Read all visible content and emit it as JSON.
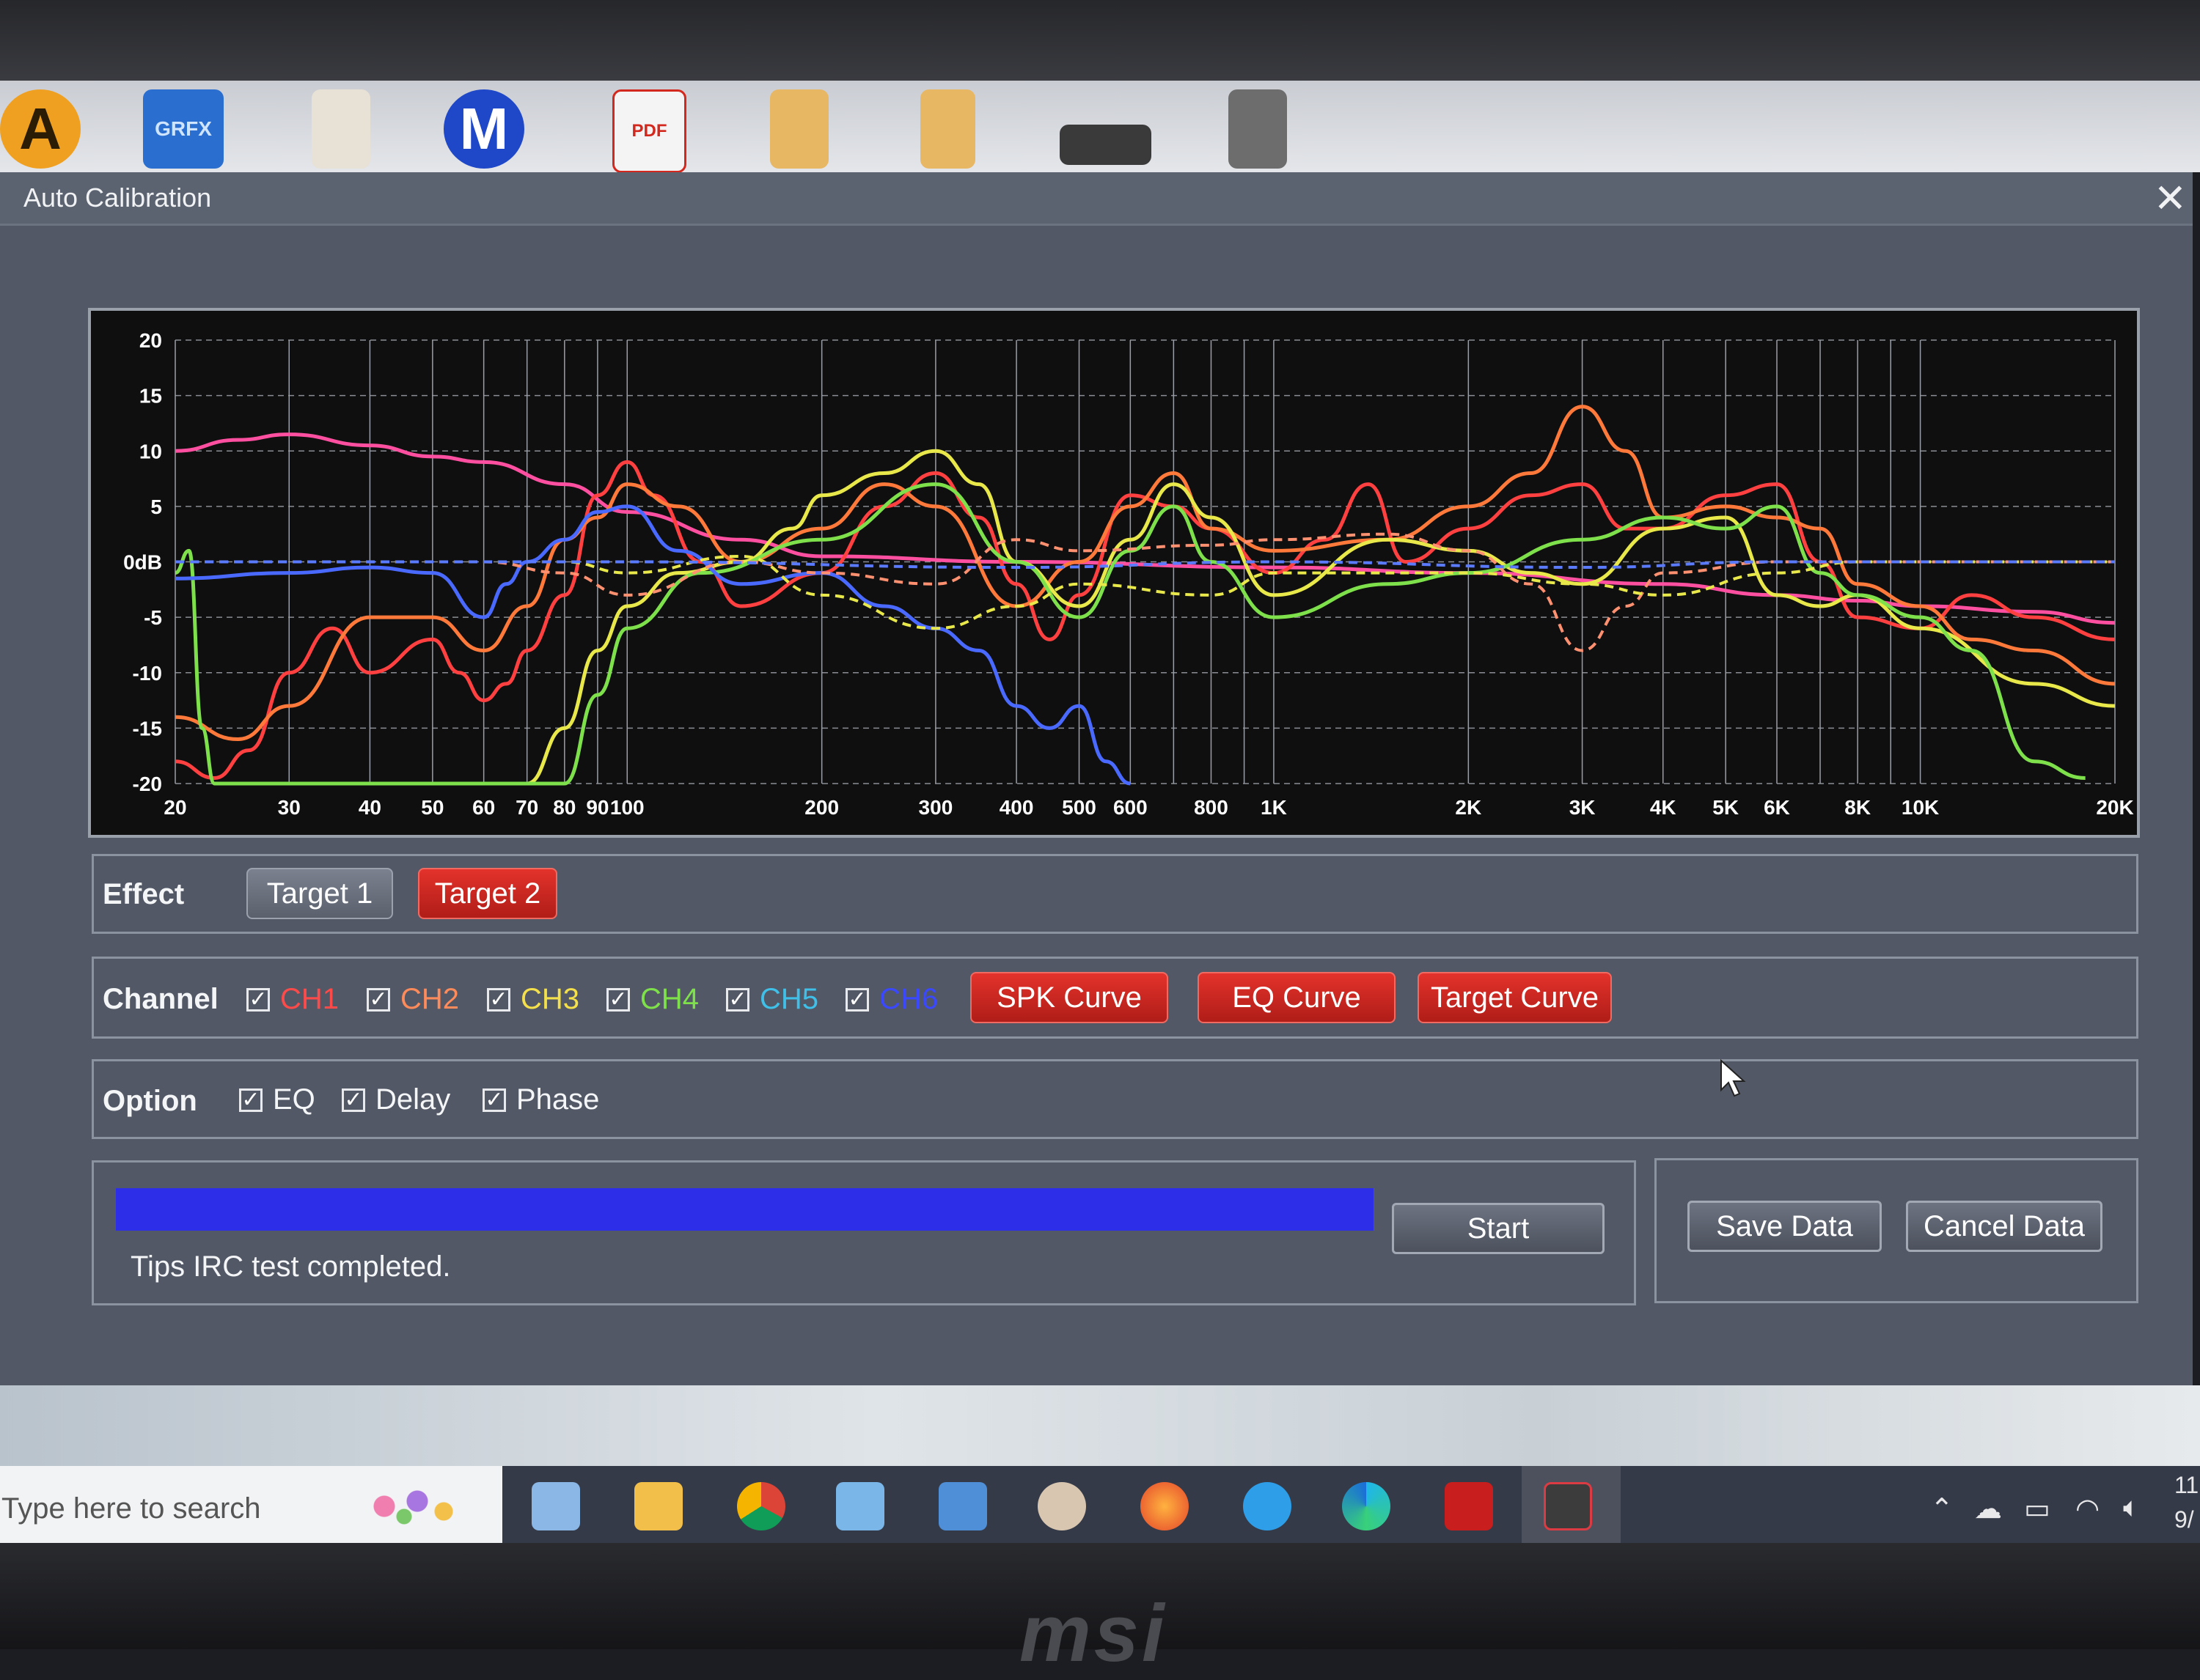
{
  "desktop": {
    "icons": [
      {
        "name": "avast-icon",
        "label": "A",
        "color": "#f0a020"
      },
      {
        "name": "grfx-icon",
        "label": "GRFX",
        "color": "#2a6fd0"
      },
      {
        "name": "pdf-file-icon",
        "label": "",
        "color": "#e8e1d6"
      },
      {
        "name": "malwarebytes-icon",
        "label": "M",
        "color": "#1f48c8"
      },
      {
        "name": "acrobat-pdf-icon",
        "label": "PDF",
        "color": "#f4f4f4"
      },
      {
        "name": "folder-icon",
        "label": "",
        "color": "#e7b764"
      },
      {
        "name": "folder-icon-2",
        "label": "",
        "color": "#e7b764"
      },
      {
        "name": "video-thumbnail-icon",
        "label": "",
        "color": "#3a3a3a"
      },
      {
        "name": "folder-image-icon",
        "label": "",
        "color": "#6d6d6d"
      }
    ]
  },
  "window": {
    "title": "Auto Calibration",
    "close_glyph": "✕"
  },
  "chart_data": {
    "type": "line",
    "x_scale": "log",
    "xlim": [
      20,
      20000
    ],
    "ylim": [
      -20,
      20
    ],
    "y_ticks": [
      "20",
      "15",
      "10",
      "5",
      "0dB",
      "-5",
      "-10",
      "-15",
      "-20"
    ],
    "x_ticks": [
      {
        "v": 20,
        "l": "20"
      },
      {
        "v": 30,
        "l": "30"
      },
      {
        "v": 40,
        "l": "40"
      },
      {
        "v": 50,
        "l": "50"
      },
      {
        "v": 60,
        "l": "60"
      },
      {
        "v": 70,
        "l": "70"
      },
      {
        "v": 80,
        "l": "80"
      },
      {
        "v": 90,
        "l": "90"
      },
      {
        "v": 100,
        "l": "100"
      },
      {
        "v": 200,
        "l": "200"
      },
      {
        "v": 300,
        "l": "300"
      },
      {
        "v": 400,
        "l": "400"
      },
      {
        "v": 500,
        "l": "500"
      },
      {
        "v": 600,
        "l": "600"
      },
      {
        "v": 800,
        "l": "800"
      },
      {
        "v": 1000,
        "l": "1K"
      },
      {
        "v": 2000,
        "l": "2K"
      },
      {
        "v": 3000,
        "l": "3K"
      },
      {
        "v": 4000,
        "l": "4K"
      },
      {
        "v": 5000,
        "l": "5K"
      },
      {
        "v": 6000,
        "l": "6K"
      },
      {
        "v": 8000,
        "l": "8K"
      },
      {
        "v": 10000,
        "l": "10K"
      },
      {
        "v": 20000,
        "l": "20K"
      }
    ],
    "grid": true,
    "series": [
      {
        "color": "#ff4fa0",
        "dashed": false,
        "points": [
          [
            20,
            10
          ],
          [
            25,
            11
          ],
          [
            30,
            11.5
          ],
          [
            40,
            10.5
          ],
          [
            50,
            9.5
          ],
          [
            60,
            9
          ],
          [
            80,
            7
          ],
          [
            100,
            4.5
          ],
          [
            150,
            2
          ],
          [
            200,
            0.5
          ],
          [
            400,
            0
          ],
          [
            1000,
            -0.5
          ],
          [
            2000,
            -1
          ],
          [
            4000,
            -2
          ],
          [
            6000,
            -3
          ],
          [
            8000,
            -3.5
          ],
          [
            10000,
            -4
          ],
          [
            15000,
            -4.5
          ],
          [
            20000,
            -5.5
          ]
        ]
      },
      {
        "color": "#ff4040",
        "dashed": false,
        "points": [
          [
            20,
            -18
          ],
          [
            23,
            -19.5
          ],
          [
            26,
            -17
          ],
          [
            30,
            -10
          ],
          [
            35,
            -6
          ],
          [
            40,
            -10
          ],
          [
            50,
            -7
          ],
          [
            55,
            -10
          ],
          [
            60,
            -12.5
          ],
          [
            65,
            -11
          ],
          [
            70,
            -8
          ],
          [
            80,
            -3
          ],
          [
            90,
            6
          ],
          [
            100,
            9
          ],
          [
            110,
            6
          ],
          [
            130,
            0
          ],
          [
            150,
            -4
          ],
          [
            200,
            -1
          ],
          [
            250,
            5
          ],
          [
            300,
            8
          ],
          [
            350,
            4
          ],
          [
            400,
            -2
          ],
          [
            450,
            -7
          ],
          [
            500,
            -3
          ],
          [
            600,
            6
          ],
          [
            700,
            5
          ],
          [
            800,
            3
          ],
          [
            1000,
            -1
          ],
          [
            1200,
            2
          ],
          [
            1400,
            7
          ],
          [
            1600,
            0
          ],
          [
            2000,
            3
          ],
          [
            2500,
            6
          ],
          [
            3000,
            7
          ],
          [
            3500,
            3
          ],
          [
            4000,
            3
          ],
          [
            5000,
            6
          ],
          [
            6000,
            7
          ],
          [
            7000,
            0
          ],
          [
            8000,
            -5
          ],
          [
            10000,
            -6
          ],
          [
            12000,
            -3
          ],
          [
            15000,
            -5
          ],
          [
            20000,
            -7
          ]
        ]
      },
      {
        "color": "#ff7a3a",
        "dashed": false,
        "points": [
          [
            20,
            -14
          ],
          [
            25,
            -16
          ],
          [
            30,
            -13
          ],
          [
            40,
            -5
          ],
          [
            50,
            -5
          ],
          [
            60,
            -8
          ],
          [
            70,
            -4
          ],
          [
            80,
            2
          ],
          [
            90,
            4
          ],
          [
            100,
            7
          ],
          [
            120,
            5
          ],
          [
            150,
            0
          ],
          [
            200,
            3
          ],
          [
            250,
            7
          ],
          [
            300,
            5
          ],
          [
            400,
            -4
          ],
          [
            500,
            0
          ],
          [
            600,
            5
          ],
          [
            700,
            8
          ],
          [
            800,
            3
          ],
          [
            1000,
            1
          ],
          [
            1500,
            2
          ],
          [
            2000,
            5
          ],
          [
            2500,
            8
          ],
          [
            3000,
            14
          ],
          [
            3500,
            10
          ],
          [
            4000,
            4
          ],
          [
            5000,
            5
          ],
          [
            6000,
            4
          ],
          [
            7000,
            3
          ],
          [
            8000,
            -2
          ],
          [
            10000,
            -4
          ],
          [
            12000,
            -7
          ],
          [
            15000,
            -8
          ],
          [
            20000,
            -11
          ]
        ]
      },
      {
        "color": "#e8e84a",
        "dashed": false,
        "points": [
          [
            70,
            -20
          ],
          [
            80,
            -15
          ],
          [
            90,
            -8
          ],
          [
            100,
            -4
          ],
          [
            120,
            -1
          ],
          [
            150,
            0
          ],
          [
            180,
            3
          ],
          [
            200,
            6
          ],
          [
            250,
            8
          ],
          [
            300,
            10
          ],
          [
            350,
            7
          ],
          [
            400,
            0
          ],
          [
            500,
            -4
          ],
          [
            600,
            2
          ],
          [
            700,
            7
          ],
          [
            800,
            4
          ],
          [
            1000,
            -3
          ],
          [
            1500,
            2
          ],
          [
            2000,
            1
          ],
          [
            2500,
            -1
          ],
          [
            3000,
            -2
          ],
          [
            4000,
            3
          ],
          [
            5000,
            4
          ],
          [
            6000,
            -3
          ],
          [
            7000,
            -4
          ],
          [
            8000,
            -3
          ],
          [
            10000,
            -6
          ],
          [
            15000,
            -11
          ],
          [
            20000,
            -13
          ]
        ]
      },
      {
        "color": "#7ee04a",
        "dashed": false,
        "points": [
          [
            20,
            -1
          ],
          [
            21,
            1
          ],
          [
            22,
            -15
          ],
          [
            23,
            -20
          ],
          [
            80,
            -20
          ],
          [
            90,
            -12
          ],
          [
            100,
            -6
          ],
          [
            130,
            -1
          ],
          [
            200,
            2
          ],
          [
            300,
            7
          ],
          [
            400,
            0
          ],
          [
            500,
            -5
          ],
          [
            600,
            1
          ],
          [
            700,
            5
          ],
          [
            800,
            0
          ],
          [
            1000,
            -5
          ],
          [
            1500,
            -2
          ],
          [
            2000,
            -1
          ],
          [
            3000,
            2
          ],
          [
            4000,
            4
          ],
          [
            5000,
            3
          ],
          [
            6000,
            5
          ],
          [
            7000,
            -1
          ],
          [
            8000,
            -3
          ],
          [
            10000,
            -5
          ],
          [
            12000,
            -8
          ],
          [
            15000,
            -18
          ],
          [
            18000,
            -19.5
          ]
        ]
      },
      {
        "color": "#4a6aff",
        "dashed": false,
        "points": [
          [
            20,
            -1.5
          ],
          [
            30,
            -1
          ],
          [
            40,
            -0.5
          ],
          [
            50,
            -1
          ],
          [
            60,
            -5
          ],
          [
            65,
            -2
          ],
          [
            70,
            0
          ],
          [
            80,
            2
          ],
          [
            90,
            4.5
          ],
          [
            100,
            5
          ],
          [
            120,
            1
          ],
          [
            150,
            -2
          ],
          [
            200,
            -1
          ],
          [
            250,
            -4
          ],
          [
            300,
            -6
          ],
          [
            350,
            -8
          ],
          [
            400,
            -13
          ],
          [
            450,
            -15
          ],
          [
            500,
            -13
          ],
          [
            550,
            -18
          ],
          [
            600,
            -20
          ]
        ]
      },
      {
        "color": "#ff9070",
        "dashed": true,
        "points": [
          [
            20,
            0
          ],
          [
            60,
            0
          ],
          [
            80,
            -1
          ],
          [
            100,
            -3
          ],
          [
            150,
            0
          ],
          [
            200,
            -1
          ],
          [
            300,
            -2
          ],
          [
            400,
            2
          ],
          [
            500,
            1
          ],
          [
            800,
            1.5
          ],
          [
            1000,
            2
          ],
          [
            1500,
            2.5
          ],
          [
            2000,
            1
          ],
          [
            2500,
            -2
          ],
          [
            3000,
            -8
          ],
          [
            3500,
            -4
          ],
          [
            4000,
            -1
          ],
          [
            6000,
            0
          ],
          [
            10000,
            0
          ],
          [
            20000,
            0
          ]
        ]
      },
      {
        "color": "#e8e84a",
        "dashed": true,
        "points": [
          [
            20,
            0
          ],
          [
            80,
            0
          ],
          [
            100,
            -1
          ],
          [
            150,
            0.5
          ],
          [
            200,
            -3
          ],
          [
            300,
            -6
          ],
          [
            400,
            -4
          ],
          [
            500,
            -2
          ],
          [
            800,
            -3
          ],
          [
            1000,
            -1
          ],
          [
            2000,
            -1
          ],
          [
            3000,
            -2
          ],
          [
            4000,
            -3
          ],
          [
            6000,
            -1
          ],
          [
            8000,
            0
          ],
          [
            20000,
            0
          ]
        ]
      },
      {
        "color": "#5a7aff",
        "dashed": true,
        "points": [
          [
            20,
            0
          ],
          [
            100,
            0
          ],
          [
            400,
            -0.5
          ],
          [
            1000,
            0
          ],
          [
            3000,
            -0.5
          ],
          [
            6000,
            0
          ],
          [
            20000,
            0
          ]
        ]
      }
    ]
  },
  "effect": {
    "label": "Effect",
    "target1": "Target 1",
    "target2": "Target 2"
  },
  "channel": {
    "label": "Channel",
    "items": [
      {
        "label": "CH1",
        "color": "#ff4a4a"
      },
      {
        "label": "CH2",
        "color": "#ff8a5a"
      },
      {
        "label": "CH3",
        "color": "#f4e04a"
      },
      {
        "label": "CH4",
        "color": "#7ee04a"
      },
      {
        "label": "CH5",
        "color": "#3fc0e8"
      },
      {
        "label": "CH6",
        "color": "#3a48ff"
      }
    ],
    "spk_curve": "SPK Curve",
    "eq_curve": "EQ Curve",
    "target_curve": "Target Curve"
  },
  "option": {
    "label": "Option",
    "eq": "EQ",
    "delay": "Delay",
    "phase": "Phase"
  },
  "progress": {
    "value": 1.0,
    "fill_color": "#2c2ee8",
    "start": "Start",
    "tips": "Tips IRC test completed."
  },
  "data_actions": {
    "save": "Save Data",
    "cancel": "Cancel Data"
  },
  "taskbar": {
    "search_placeholder": "Type here to search",
    "tray_time": "11",
    "tray_date": "9/"
  },
  "brand": "msi"
}
